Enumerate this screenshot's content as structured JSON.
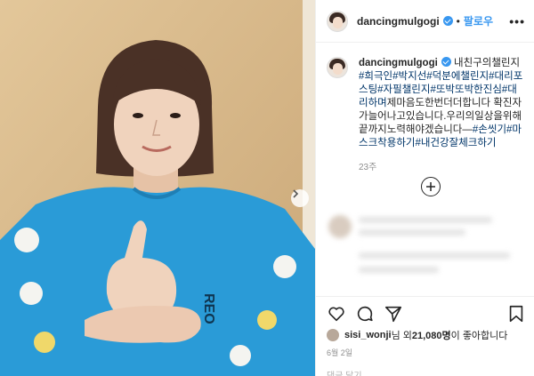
{
  "post": {
    "username": "dancingmulgogi",
    "follow_label": "팔로우",
    "separator": "•",
    "more_label": "•••",
    "caption_user": "dancingmulgogi",
    "caption_text": "내친구의챌린지",
    "caption_tags_1": "#희극인#박지선#덕분에챌린지#대리포스팅#자필챌린지#또박또박한진심#대리하며",
    "caption_text_2": "제마음도한번더더합니다 확진자가늘어나고있습니다.우리의일상을위해끝까지노력해야겠습니다—",
    "caption_tags_2": "#손씻기#마스크착용하기#내건강잘체크하기",
    "time_ago": "23주",
    "likes_user": "sisi_wonji",
    "likes_mid": "님 외 ",
    "likes_count": "21,080명",
    "likes_suffix": "이 좋아합니다",
    "date": "6월 2일",
    "bottom_text": "댓글 달기..."
  },
  "colors": {
    "accent": "#3897f0",
    "hashtag": "#003569",
    "muted": "#8e8e8e",
    "sweater": "#2a9bd7"
  },
  "icons": [
    "verified-badge-icon",
    "more-options-icon",
    "next-photo-icon",
    "load-more-comments-icon",
    "heart-icon",
    "comment-icon",
    "share-icon",
    "bookmark-icon"
  ]
}
